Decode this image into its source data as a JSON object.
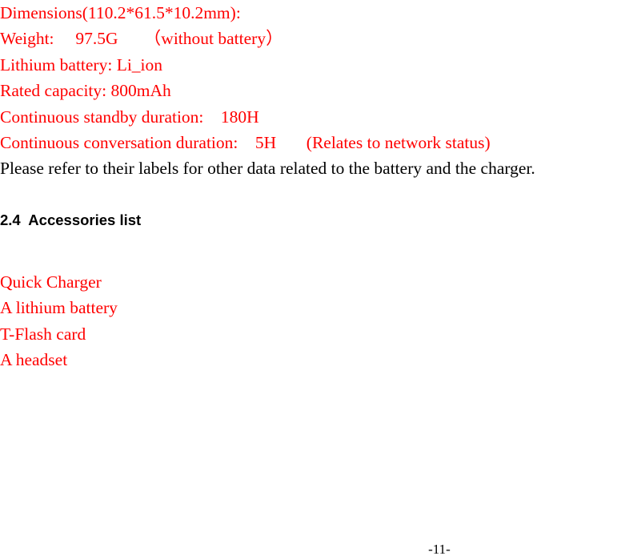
{
  "document": {
    "page_number": "-11-",
    "colors": {
      "spec_text": "#ff0000",
      "body_text": "#000000",
      "background": "#ffffff"
    },
    "specifications": {
      "lines": [
        "Dimensions(110.2*61.5*10.2mm):",
        "Weight:     97.5G      （without battery）",
        "Lithium battery: Li_ion",
        "Rated capacity: 800mAh",
        "Continuous standby duration:    180H",
        "Continuous conversation duration:    5H       (Relates to network status)"
      ],
      "note": "Please refer to their labels for other data related to the battery and the charger."
    },
    "section": {
      "number": "2.4",
      "heading": "2.4  Accessories list",
      "title": "Accessories list",
      "items": [
        "Quick Charger",
        "A lithium battery",
        "T-Flash card",
        "A headset"
      ]
    }
  }
}
